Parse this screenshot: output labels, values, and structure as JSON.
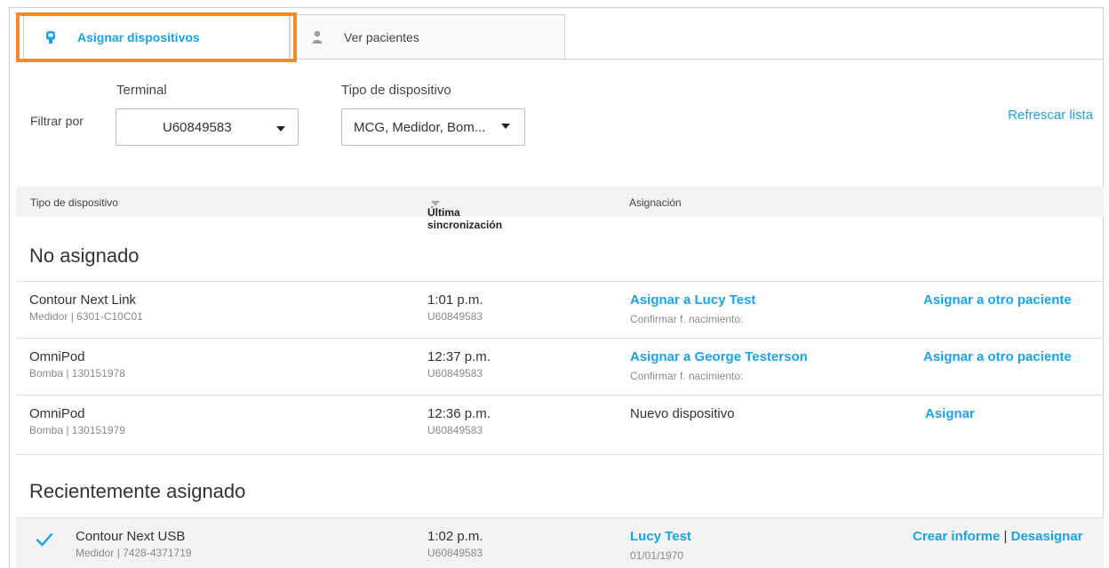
{
  "tabs": [
    {
      "label": "Asignar dispositivos",
      "icon": "device-icon",
      "active": true
    },
    {
      "label": "Ver pacientes",
      "icon": "person-icon",
      "active": false
    }
  ],
  "filters": {
    "label": "Filtrar por",
    "terminal_caption": "Terminal",
    "terminal_value": "U60849583",
    "type_caption": "Tipo de dispositivo",
    "type_value": "MCG, Medidor, Bom...",
    "refresh_label": "Refrescar lista"
  },
  "table": {
    "col_type": "Tipo de dispositivo",
    "col_sync": "Última sincronización",
    "col_assign": "Asignación"
  },
  "sections": {
    "unassigned": "No asignado",
    "recent": "Recientemente asignado"
  },
  "rows": [
    {
      "device": "Contour Next Link",
      "detail": "Medidor | 6301-C10C01",
      "time": "1:01 p.m.",
      "terminal": "U60849583",
      "assign_link": "Asignar a  Lucy Test",
      "assign_sub": "Confirmar f. nacimiento:",
      "other_link": "Asignar a otro paciente"
    },
    {
      "device": "OmniPod",
      "detail": "Bomba | 130151978",
      "time": "12:37 p.m.",
      "terminal": "U60849583",
      "assign_link": "Asignar a  George Testerson",
      "assign_sub": "Confirmar f. nacimiento:",
      "other_link": "Asignar a otro paciente"
    },
    {
      "device": "OmniPod",
      "detail": "Bomba | 130151979",
      "time": "12:36 p.m.",
      "terminal": "U60849583",
      "assign_text": "Nuevo dispositivo",
      "other_link": "Asignar"
    }
  ],
  "recent_rows": [
    {
      "device": "Contour Next USB",
      "detail": "Medidor | 7428-4371719",
      "time": "1:02 p.m.",
      "terminal": "U60849583",
      "patient_link": "Lucy Test",
      "patient_dob": "01/01/1970",
      "report_link": "Crear informe",
      "separator": "|",
      "unassign_link": "Desasignar"
    }
  ],
  "colors": {
    "accent": "#1aa3e8",
    "highlight": "#f58a28",
    "header_bg": "#f2f2f2"
  }
}
